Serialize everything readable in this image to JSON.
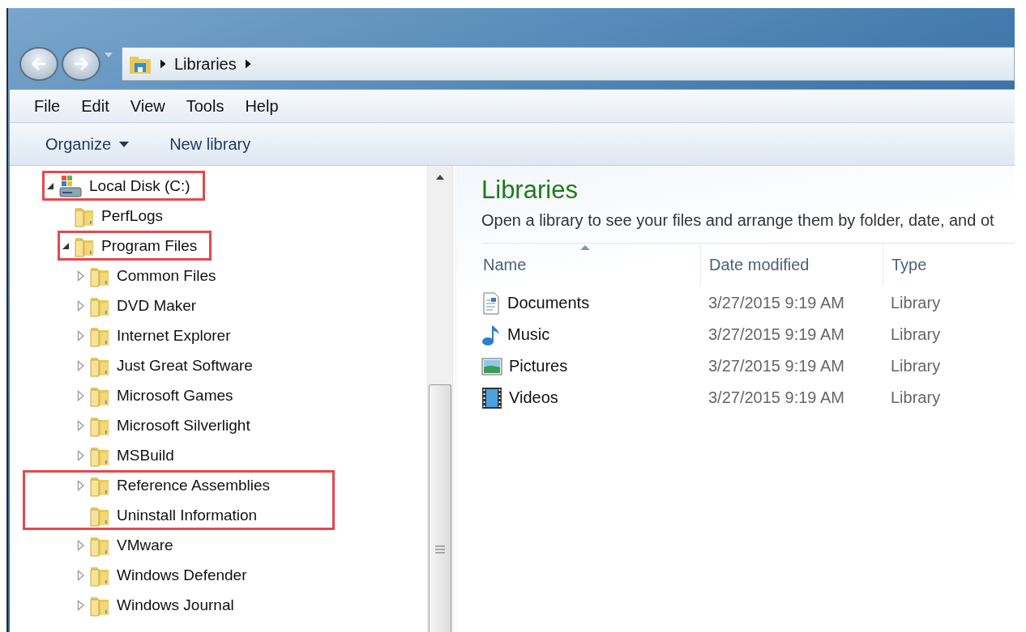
{
  "address_bar": {
    "crumbs": [
      "Libraries"
    ]
  },
  "menu_bar": [
    "File",
    "Edit",
    "View",
    "Tools",
    "Help"
  ],
  "toolbar": [
    {
      "label": "Organize",
      "dropdown": true
    },
    {
      "label": "New library",
      "dropdown": false
    }
  ],
  "tree": [
    {
      "label": "Local Disk (C:)",
      "kind": "drive",
      "expanded": true,
      "highlighted": true,
      "children": [
        {
          "label": "PerfLogs",
          "kind": "folder",
          "highlighted": false
        },
        {
          "label": "Program Files",
          "kind": "folder",
          "expanded": true,
          "highlighted": true,
          "children": [
            {
              "label": "Common Files",
              "kind": "folder",
              "expanded": false,
              "highlighted": false
            },
            {
              "label": "DVD Maker",
              "kind": "folder",
              "expanded": false,
              "highlighted": false
            },
            {
              "label": "Internet Explorer",
              "kind": "folder",
              "expanded": false,
              "highlighted": false
            },
            {
              "label": "Just Great Software",
              "kind": "folder",
              "expanded": false,
              "highlighted": false
            },
            {
              "label": "Microsoft Games",
              "kind": "folder",
              "expanded": false,
              "highlighted": false
            },
            {
              "label": "Microsoft Silverlight",
              "kind": "folder",
              "expanded": false,
              "highlighted": false
            },
            {
              "label": "MSBuild",
              "kind": "folder",
              "expanded": false,
              "highlighted": false
            },
            {
              "label": "Reference Assemblies",
              "kind": "folder",
              "expanded": false,
              "highlighted": true
            },
            {
              "label": "Uninstall Information",
              "kind": "folder",
              "highlighted": true
            },
            {
              "label": "VMware",
              "kind": "folder",
              "expanded": false,
              "highlighted": false
            },
            {
              "label": "Windows Defender",
              "kind": "folder",
              "expanded": false,
              "highlighted": false
            },
            {
              "label": "Windows Journal",
              "kind": "folder",
              "expanded": false,
              "highlighted": false
            }
          ]
        }
      ]
    }
  ],
  "content": {
    "title": "Libraries",
    "subtitle": "Open a library to see your files and arrange them by folder, date, and ot",
    "columns": [
      "Name",
      "Date modified",
      "Type"
    ],
    "rows": [
      {
        "kind": "documents",
        "name": "Documents",
        "date": "3/27/2015 9:19 AM",
        "type": "Library"
      },
      {
        "kind": "music",
        "name": "Music",
        "date": "3/27/2015 9:19 AM",
        "type": "Library"
      },
      {
        "kind": "pictures",
        "name": "Pictures",
        "date": "3/27/2015 9:19 AM",
        "type": "Library"
      },
      {
        "kind": "videos",
        "name": "Videos",
        "date": "3/27/2015 9:19 AM",
        "type": "Library"
      }
    ]
  }
}
